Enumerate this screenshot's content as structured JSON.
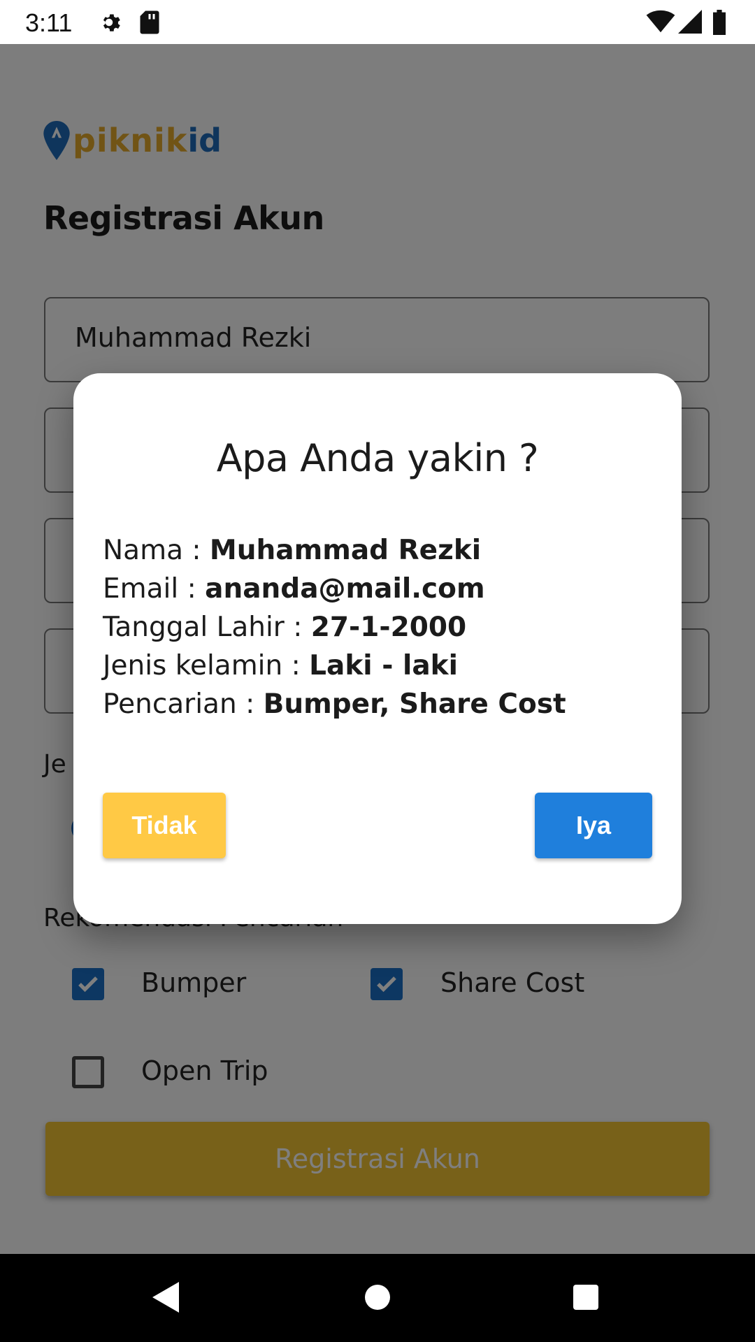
{
  "status_bar": {
    "time": "3:11",
    "icons": [
      "settings-icon",
      "sd-card-icon",
      "wifi-icon",
      "signal-icon",
      "battery-icon"
    ]
  },
  "app": {
    "logo": {
      "part1": "piknik",
      "part2": "id"
    },
    "page_title": "Registrasi Akun",
    "fields": {
      "name_value": "Muhammad Rezki"
    },
    "section_gender_label": "Je",
    "section_reco_label": "Rekomendasi Pencarian",
    "checkboxes": [
      {
        "label": "Bumper",
        "checked": true
      },
      {
        "label": "Share Cost",
        "checked": true
      },
      {
        "label": "Open Trip",
        "checked": false
      }
    ],
    "submit_label": "Registrasi Akun"
  },
  "dialog": {
    "title": "Apa Anda yakin ?",
    "rows": [
      {
        "label": "Nama : ",
        "value": "Muhammad Rezki"
      },
      {
        "label": "Email : ",
        "value": "ananda@mail.com"
      },
      {
        "label": "Tanggal Lahir : ",
        "value": "27-1-2000"
      },
      {
        "label": "Jenis kelamin : ",
        "value": "Laki - laki"
      },
      {
        "label": "Pencarian : ",
        "value": "Bumper, Share Cost"
      }
    ],
    "no_label": "Tidak",
    "yes_label": "Iya"
  },
  "colors": {
    "accent_blue": "#1f7fdc",
    "accent_yellow": "#ffc945",
    "logo_yellow": "#e3a82b"
  }
}
